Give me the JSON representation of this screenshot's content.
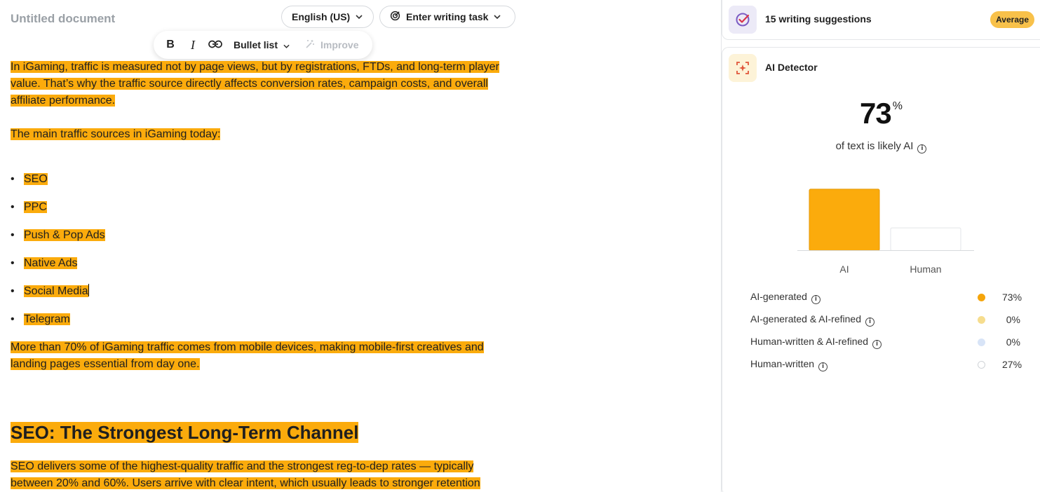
{
  "document": {
    "title": "Untitled document",
    "language": "English (US)",
    "writing_task": "Enter writing task"
  },
  "toolbar": {
    "bold": "B",
    "italic": "I",
    "bullet_list": "Bullet list",
    "improve": "Improve"
  },
  "content": {
    "p1": "In iGaming, traffic is measured not by page views, but by registrations, FTDs, and long-term player value. That’s why the traffic source directly affects conversion rates, campaign costs, and overall affiliate performance.",
    "p2": "The main traffic sources in iGaming today:",
    "bullets": [
      "SEO",
      "PPC",
      "Push & Pop Ads",
      "Native Ads",
      "Social Media",
      "Telegram"
    ],
    "p3": "More than 70% of iGaming traffic comes from mobile devices, making mobile-first creatives and landing pages essential from day one.",
    "h2": "SEO: The Strongest Long-Term Channel",
    "p4": "SEO delivers some of the highest-quality traffic and the strongest reg-to-dep rates — typically between 20% and 60%. Users arrive with clear intent, which usually leads to stronger retention"
  },
  "suggestions": {
    "label": "15 writing suggestions",
    "badge": "Average"
  },
  "ai_detector": {
    "title": "AI Detector",
    "percent": "73",
    "percent_sign": "%",
    "caption": "of text is likely AI",
    "legend": [
      {
        "label": "AI-generated",
        "value": "73%",
        "color": "#f5a50b"
      },
      {
        "label": "AI-generated & AI-refined",
        "value": "0%",
        "color": "#f6dd8e"
      },
      {
        "label": "Human-written & AI-refined",
        "value": "0%",
        "color": "#d8e4f7"
      },
      {
        "label": "Human-written",
        "value": "27%",
        "color": "#ffffff"
      }
    ]
  },
  "chart_data": {
    "type": "bar",
    "categories": [
      "AI",
      "Human"
    ],
    "values": [
      73,
      27
    ],
    "colors": [
      "#fbab0c",
      "#ffffff"
    ],
    "ylim": [
      0,
      100
    ],
    "grid": false,
    "legend": "none"
  },
  "colors": {
    "highlight": "#fbab0c",
    "badge": "#f8c14a"
  }
}
